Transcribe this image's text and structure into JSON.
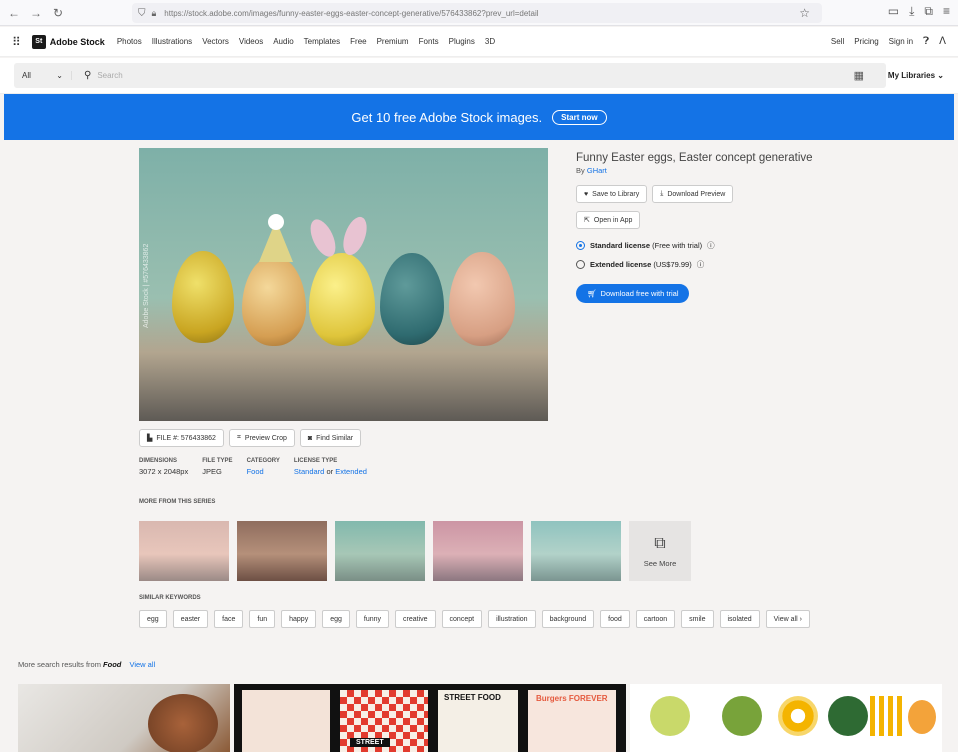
{
  "browser": {
    "url": "https://stock.adobe.com/images/funny-easter-eggs-easter-concept-generative/576433862?prev_url=detail"
  },
  "appbar": {
    "logo": "St",
    "brand": "Adobe Stock",
    "menu": [
      "Photos",
      "Illustrations",
      "Vectors",
      "Videos",
      "Audio",
      "Templates",
      "Free",
      "Premium",
      "Fonts",
      "Plugins",
      "3D"
    ],
    "right": [
      "Sell",
      "Pricing",
      "Sign in"
    ]
  },
  "search": {
    "category": "All",
    "placeholder": "Search",
    "libraries": "My Libraries"
  },
  "banner": {
    "text": "Get 10 free Adobe Stock images.",
    "cta": "Start now"
  },
  "asset": {
    "watermark": "Adobe Stock | #576433862",
    "title": "Funny Easter eggs, Easter concept generative",
    "by": "By",
    "author": "GHart",
    "save": "Save to Library",
    "download_preview": "Download Preview",
    "open_app": "Open in App",
    "standard_license": "Standard license",
    "standard_note": "(Free with trial)",
    "extended_license": "Extended license",
    "extended_note": "(US$79.99)",
    "download_button": "Download free with trial",
    "file_no": "FILE #: 576433862",
    "preview_crop": "Preview Crop",
    "find_similar": "Find Similar"
  },
  "meta": {
    "dimensions_label": "DIMENSIONS",
    "dimensions": "3072 x 2048px",
    "filetype_label": "FILE TYPE",
    "filetype": "JPEG",
    "category_label": "CATEGORY",
    "category": "Food",
    "license_label": "LICENSE TYPE",
    "license_standard": "Standard",
    "license_or": "or",
    "license_extended": "Extended"
  },
  "series": {
    "heading": "MORE FROM THIS SERIES",
    "see_more": "See More"
  },
  "keywords": {
    "heading": "SIMILAR KEYWORDS",
    "items": [
      "egg",
      "easter",
      "face",
      "fun",
      "happy",
      "egg",
      "funny",
      "creative",
      "concept",
      "illustration",
      "background",
      "food",
      "cartoon",
      "smile",
      "isolated"
    ],
    "view_all": "View all ›"
  },
  "more_results": {
    "prefix": "More search results from",
    "term": "Food",
    "view_all": "View all"
  },
  "bottom": {
    "card2_texts": [
      "STREET FOOD",
      "Burgers FOREVER",
      "STREET"
    ]
  },
  "colors": {
    "accent": "#1473e6"
  }
}
